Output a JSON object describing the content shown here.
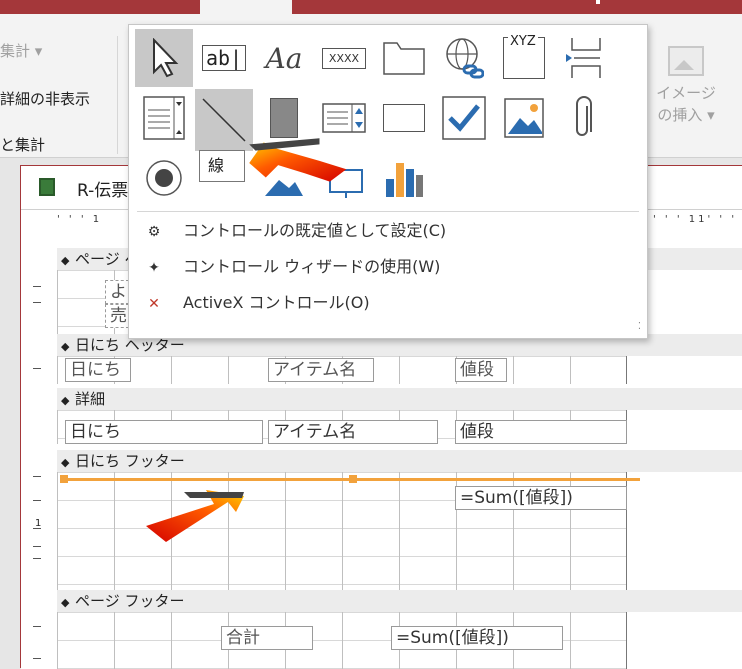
{
  "ribbon": {
    "item_total": "集計",
    "item_hide_details": "詳細の非表示",
    "group_label": "と集計",
    "image_insert_line1": "イメージ",
    "image_insert_line2": "の挿入"
  },
  "document": {
    "tab_title": "R-伝票"
  },
  "ruler": {
    "marks": "' ' ' 1",
    "marks_right": "' ' ' 11' ' ' 1"
  },
  "sections": {
    "page_header": "ページ ヘ",
    "page_header_labels": [
      "よ",
      "売"
    ],
    "date_header": "日にち ヘッター",
    "detail": "詳細",
    "date_footer": "日にち フッター",
    "page_footer": "ページ フッター"
  },
  "controls": {
    "hdr_date_label": "日にち",
    "hdr_item_label": "アイテム名",
    "hdr_price_label": "値段",
    "detail_date": "日にち",
    "detail_item": "アイテム名",
    "detail_price": "値段",
    "footer_sum": "=Sum([値段])",
    "pagefooter_total_label": "合計",
    "pagefooter_sum": "=Sum([値段])"
  },
  "popup": {
    "tooltip": "線",
    "tool_textbox_label": "ab|",
    "tool_label_glyph": "Aa",
    "tool_button_text": "XXXX",
    "tool_combo_text": "XYZ",
    "menu_items": [
      "コントロールの既定値として設定(C)",
      "コントロール ウィザードの使用(W)",
      "ActiveX コントロール(O)"
    ]
  },
  "vruler": {
    "numbers": [
      "1"
    ]
  },
  "colors": {
    "accent": "#a4373a",
    "selection_line": "#f2a23c",
    "tool_blue": "#2b6cb0"
  }
}
